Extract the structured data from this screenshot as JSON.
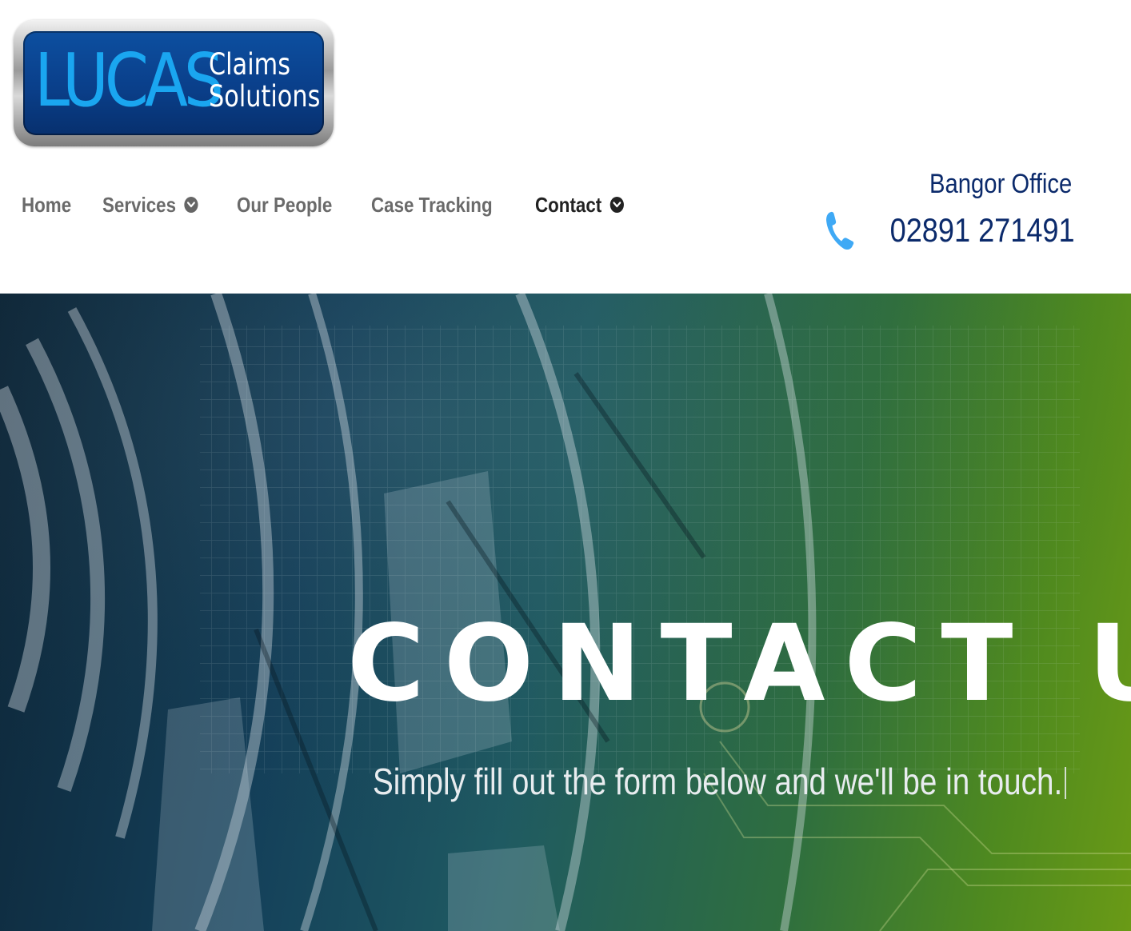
{
  "logo": {
    "word": "LUCAS",
    "sub_line1": "Claims",
    "sub_line2": "Solutions"
  },
  "nav": {
    "items": [
      {
        "label": "Home",
        "has_dropdown": false,
        "active": false
      },
      {
        "label": "Services",
        "has_dropdown": true,
        "active": false
      },
      {
        "label": "Our People",
        "has_dropdown": false,
        "active": false
      },
      {
        "label": "Case Tracking",
        "has_dropdown": false,
        "active": false
      },
      {
        "label": "Contact",
        "has_dropdown": true,
        "active": true
      }
    ],
    "dropdown_icon": "chevron-down-circle-icon"
  },
  "office": {
    "label": "Bangor Office",
    "phone": "02891 271491",
    "phone_icon": "phone-icon"
  },
  "hero": {
    "title": "CONTACT US",
    "subtitle": "Simply fill out the form below and we'll be in touch."
  },
  "colors": {
    "brand_navy": "#0b2a6b",
    "logo_blue": "#1aa6f0",
    "phone_icon": "#3fa9f5",
    "nav_text": "#6a6a6a",
    "nav_active": "#222222"
  }
}
